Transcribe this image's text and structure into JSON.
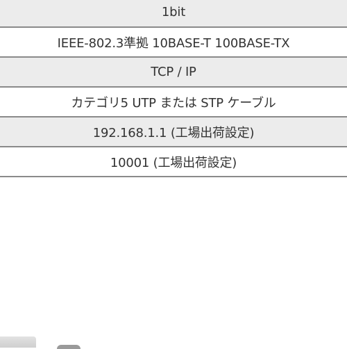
{
  "spec_rows": [
    {
      "value": "1bit",
      "shade": "gray"
    },
    {
      "value": "IEEE-802.3準拠 10BASE-T 100BASE-TX",
      "shade": "white"
    },
    {
      "value": "TCP / IP",
      "shade": "gray"
    },
    {
      "value": "カテゴリ5 UTP または STP ケーブル",
      "shade": "white"
    },
    {
      "value": "192.168.1.1 (工場出荷設定)",
      "shade": "gray"
    },
    {
      "value": "10001 (工場出荷設定)",
      "shade": "white"
    }
  ],
  "colors": {
    "row_gray": "#ececec",
    "divider": "#8a8a8a",
    "text": "#333333"
  }
}
